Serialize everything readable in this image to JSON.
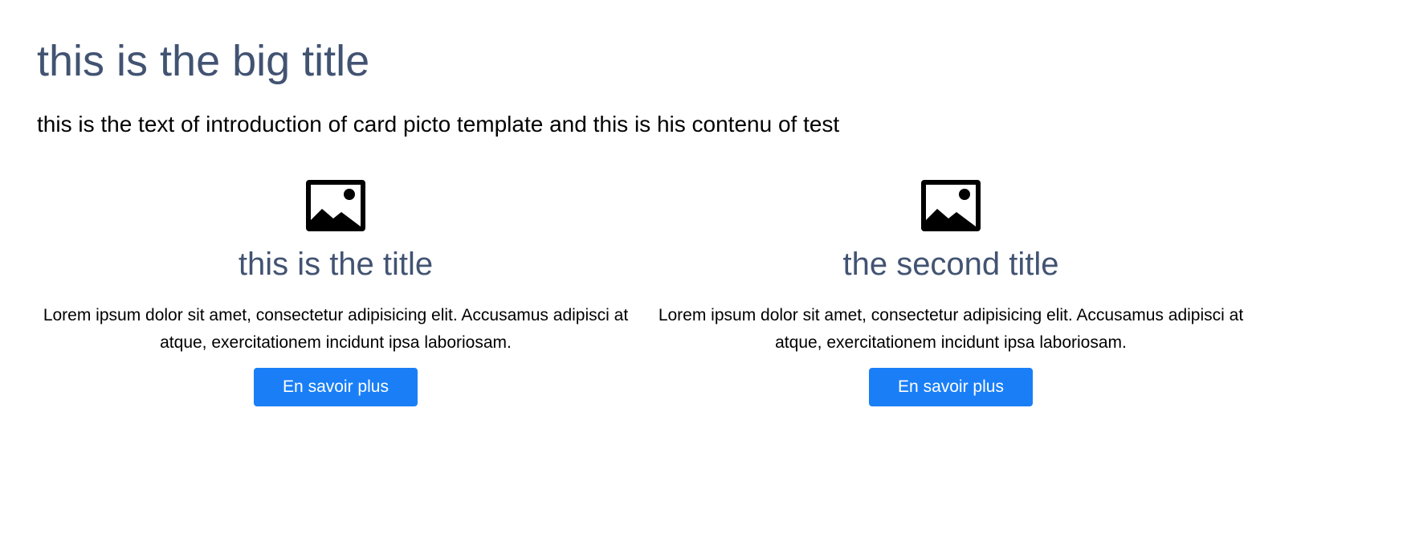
{
  "colors": {
    "title": "#425372",
    "text": "#000000",
    "button_bg": "#1a7ff7",
    "button_text": "#ffffff",
    "icon": "#000000"
  },
  "header": {
    "title": "this is the big title",
    "intro": "this is the text of introduction of card picto template and this is his contenu of test"
  },
  "cards": [
    {
      "icon": "image-icon",
      "title": "this is the title",
      "text": "Lorem ipsum dolor sit amet, consectetur adipisicing elit. Accusamus adipisci at atque, exercitationem incidunt ipsa laboriosam.",
      "button_label": "En savoir plus"
    },
    {
      "icon": "image-icon",
      "title": "the second title",
      "text": "Lorem ipsum dolor sit amet, consectetur adipisicing elit. Accusamus adipisci at atque, exercitationem incidunt ipsa laboriosam.",
      "button_label": "En savoir plus"
    }
  ]
}
